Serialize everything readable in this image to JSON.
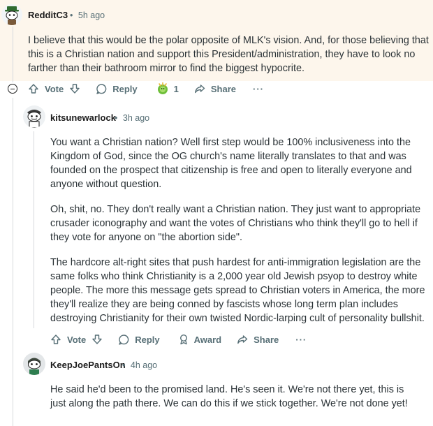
{
  "comments": [
    {
      "author": "RedditC3",
      "time": "5h ago",
      "paragraphs": [
        "I believe that this would be the polar opposite of MLK's vision. And, for those believing that this is a Christian nation and support this President/administration, they have to look no farther than their bathroom mirror to find the biggest hypocrite."
      ],
      "actions": {
        "vote": "Vote",
        "reply": "Reply",
        "award_count": "1",
        "share": "Share",
        "more": "···"
      }
    },
    {
      "author": "kitsunewarlock",
      "time": "3h ago",
      "paragraphs": [
        "You want a Christian nation? Well first step would be 100% inclusiveness into the Kingdom of God, since the OG church's name literally translates to that and was founded on the prospect that citizenship is free and open to literally everyone and anyone without question.",
        "Oh, shit, no. They don't really want a Christian nation. They just want to appropriate crusader iconography and want the votes of Christians who think they'll go to hell if they vote for anyone on \"the abortion side\".",
        "The hardcore alt-right sites that push hardest for anti-immigration legislation are the same folks who think Christianity is a 2,000 year old Jewish psyop to destroy white people. The more this message gets spread to Christian voters in America, the more they'll realize they are being conned by fascists whose long term plan includes destroying Christianity for their own twisted Nordic-larping cult of personality bullshit."
      ],
      "actions": {
        "vote": "Vote",
        "reply": "Reply",
        "award": "Award",
        "share": "Share",
        "more": "···"
      }
    },
    {
      "author": "KeepJoePantsOn",
      "time": "4h ago",
      "paragraphs": [
        "He said he'd been to the promised land. He's seen it. We're not there yet, this is just along the path there. We can do this if we stick together. We're not done yet!"
      ]
    }
  ],
  "meta_separator": "•",
  "colors": {
    "highlight": "#fdf6ec",
    "muted": "#576f76",
    "thread_line": "#d6d9dc",
    "award_green": "#6fbf3a"
  }
}
